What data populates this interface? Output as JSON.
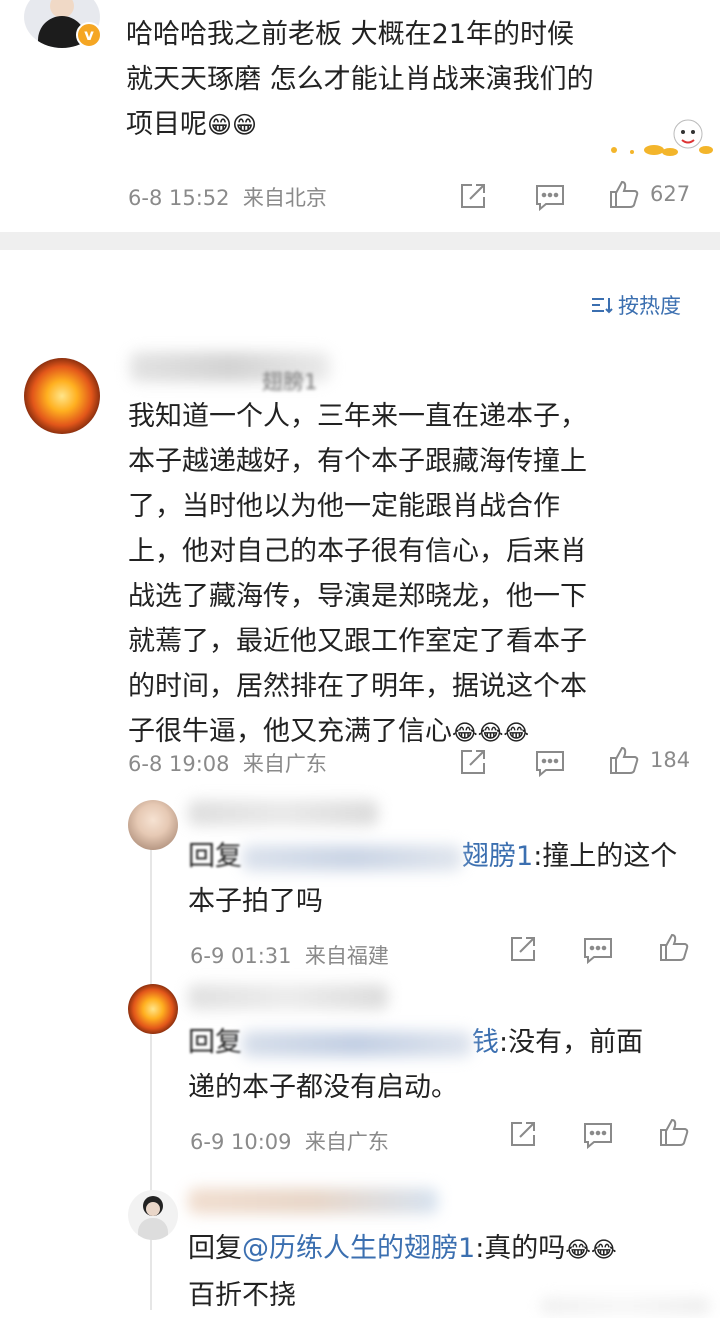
{
  "comment_top": {
    "text_line1": "哈哈哈我之前老板 大概在21年的时候",
    "text_line2": "就天天琢磨 怎么才能让肖战来演我们的",
    "text_line3": "项目呢",
    "emoji": "😁😁",
    "time": "6-8 15:52",
    "location": "来自北京",
    "like_count": "627"
  },
  "sort_label": "按热度",
  "comment_main": {
    "name_fragment": "翅膀1",
    "lines": [
      "我知道一个人，三年来一直在递本子，",
      "本子越递越好，有个本子跟藏海传撞上",
      "了，当时他以为他一定能跟肖战合作",
      "上，他对自己的本子很有信心，后来肖",
      "战选了藏海传，导演是郑晓龙，他一下",
      "就蔫了，最近他又跟工作室定了看本子",
      "的时间，居然排在了明年，据说这个本",
      "子很牛逼，他又充满了信心"
    ],
    "emoji": "😂😂😂",
    "time": "6-8 19:08",
    "location": "来自广东",
    "like_count": "184"
  },
  "reply1": {
    "prefix": "回复",
    "mention_tail": "翅膀1",
    "text_after": ":撞上的这个",
    "line2": "本子拍了吗",
    "time": "6-9 01:31",
    "location": "来自福建"
  },
  "reply2": {
    "prefix": "回复",
    "mention_tail": "钱",
    "text_after": ":没有，前面",
    "line2": "递的本子都没有启动。",
    "time": "6-9 10:09",
    "location": "来自广东"
  },
  "reply3": {
    "prefix": "回复",
    "mention": "@历练人生的翅膀1",
    "text_after": ":真的吗",
    "emoji": "😂😂",
    "line2": "百折不挠"
  },
  "colors": {
    "link": "#3b6fb0",
    "meta": "#8a8a8a",
    "divider": "#efefef",
    "badge": "#f5a623"
  }
}
